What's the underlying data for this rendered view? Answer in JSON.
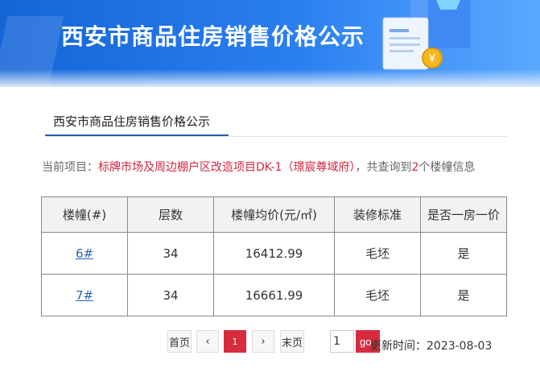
{
  "banner": {
    "title": "西安市商品住房销售价格公示"
  },
  "section": {
    "tab_label": "西安市商品住房销售价格公示"
  },
  "info": {
    "prefix": "当前项目：",
    "project": "标牌市场及周边棚户区改造项目DK-1（璟宸尊域府）",
    "mid": "，共查询到",
    "count": "2",
    "suffix": "个楼幢信息"
  },
  "table": {
    "headers": [
      "楼幢(#)",
      "层数",
      "楼幢均价(元/㎡)",
      "装修标准",
      "是否一房一价"
    ],
    "rows": [
      {
        "building": "6#",
        "floors": "34",
        "avg_price": "16412.99",
        "decoration": "毛坯",
        "one_price": "是"
      },
      {
        "building": "7#",
        "floors": "34",
        "avg_price": "16661.99",
        "decoration": "毛坯",
        "one_price": "是"
      }
    ]
  },
  "pager": {
    "first": "首页",
    "prev": "‹",
    "current": "1",
    "next": "›",
    "last": "末页",
    "page_input": "1",
    "go": "go"
  },
  "update": {
    "label": "更新时间：",
    "date": "2023-08-03"
  },
  "colors": {
    "brand_blue": "#1f6fe5",
    "accent_red": "#d62c3e",
    "link_blue": "#2a62b0"
  },
  "icons": [
    "document-illustration",
    "coin-icon"
  ]
}
